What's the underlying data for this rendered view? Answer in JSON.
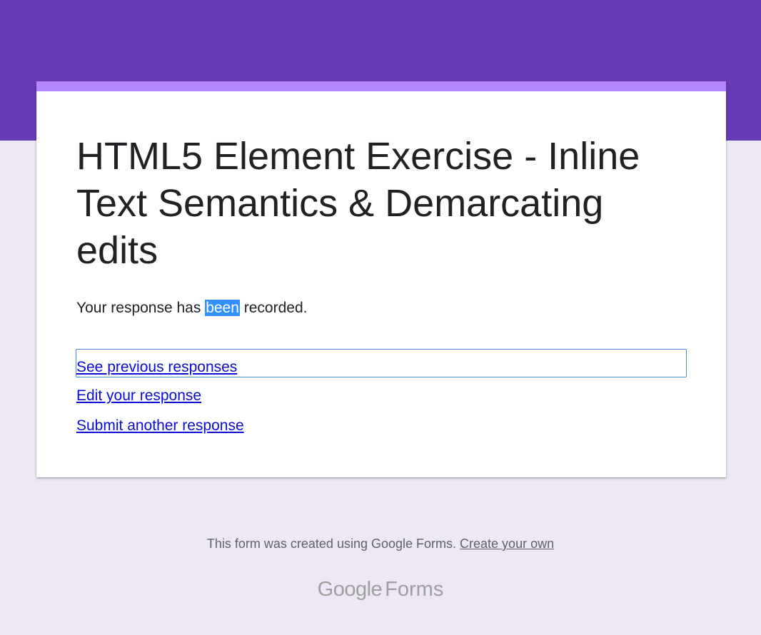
{
  "theme": {
    "header_color": "#673ab7",
    "accent_color": "#b388ff",
    "background_color": "#ede7f6",
    "selection_color": "#3390ff"
  },
  "form": {
    "title": "HTML5 Element Exercise - Inline Text Semantics & Demarcating edits",
    "confirmation": {
      "before": "Your response has ",
      "selected": "been",
      "after": " recorded."
    },
    "links": {
      "see_previous": "See previous responses",
      "edit": "Edit your response",
      "submit_another": "Submit another response"
    }
  },
  "footer": {
    "text": "This form was created using Google Forms. ",
    "link": "Create your own",
    "brand_google": "Google",
    "brand_forms": "Forms"
  }
}
